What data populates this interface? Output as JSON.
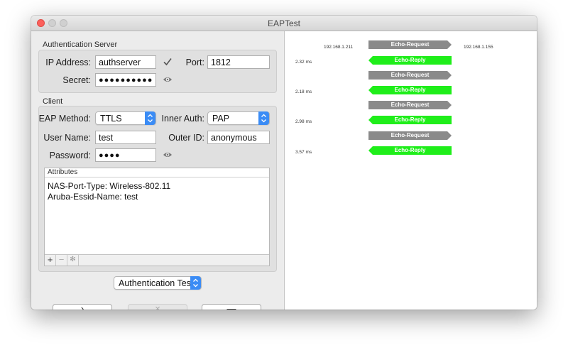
{
  "window": {
    "title": "EAPTest"
  },
  "server": {
    "group_title": "Authentication Server",
    "ip_label": "IP Address:",
    "ip_value": "authserver",
    "port_label": "Port:",
    "port_value": "1812",
    "secret_label": "Secret:",
    "secret_value": "●●●●●●●●●●"
  },
  "client": {
    "group_title": "Client",
    "eap_method_label": "EAP Method:",
    "eap_method_value": "TTLS",
    "inner_auth_label": "Inner Auth:",
    "inner_auth_value": "PAP",
    "username_label": "User Name:",
    "username_value": "test",
    "outer_id_label": "Outer ID:",
    "outer_id_value": "anonymous",
    "password_label": "Password:",
    "password_value": "●●●●",
    "attributes": {
      "header": "Attributes",
      "lines": [
        "NAS-Port-Type: Wireless-802.11",
        "Aruba-Essid-Name: test"
      ],
      "add_label": "+",
      "remove_label": "−",
      "gear_label": "✻"
    }
  },
  "test_select": {
    "value": "Authentication Test"
  },
  "buttons": {
    "run_label": "›",
    "stop_label": "×",
    "clear_label": "—"
  },
  "trace": {
    "client_ip": "192.168.1.211",
    "server_ip": "192.168.1.155",
    "request_label": "Echo-Request",
    "reply_label": "Echo-Reply",
    "request_color": "#8a8a8a",
    "reply_color": "#1fee1a",
    "timings": [
      "2.32 ms",
      "2.18 ms",
      "2.98 ms",
      "3.57 ms"
    ]
  },
  "icons": {
    "check": "checkmark-icon",
    "eye": "eye-icon",
    "stepper": "updown-chevron-icon"
  }
}
